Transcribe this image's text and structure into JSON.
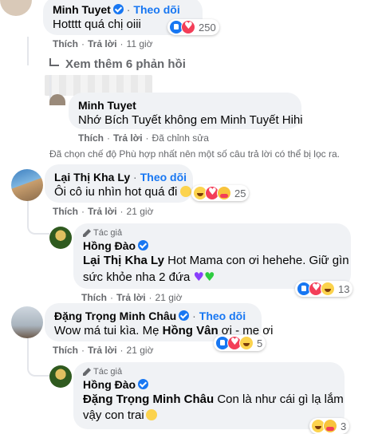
{
  "comments": [
    {
      "name": "Minh Tuyet",
      "follow": "Theo dõi",
      "text": "Hotttt quá chị oiii",
      "like": "Thích",
      "reply": "Trả lời",
      "time": "11 giờ",
      "reaction_count": "250"
    },
    {
      "name": "Lại Thị Kha Ly",
      "follow": "Theo dõi",
      "text": "Ôi cô iu nhìn hot quá đi",
      "like": "Thích",
      "reply": "Trả lời",
      "time": "21 giờ",
      "reaction_count": "25"
    },
    {
      "name": "Đặng Trọng Minh Châu",
      "follow": "Theo dõi",
      "text_prefix": "Wow má tui kìa. Mẹ",
      "mention": "Hồng Vân",
      "text_suffix": "ơi - mẹ ơi",
      "like": "Thích",
      "reply": "Trả lời",
      "time": "21 giờ",
      "reaction_count": "5"
    }
  ],
  "more_replies": "Xem thêm 6 phản hồi",
  "quoted_reply": {
    "name": "Minh Tuyet",
    "text": "Nhớ Bích Tuyết không em Minh Tuyết Hihi",
    "like": "Thích",
    "reply": "Trả lời",
    "edit": "Đã chỉnh sửa"
  },
  "filter_note": "Đã chọn chế độ Phù hợp nhất nên một số câu trả lời có thể bị lọc ra.",
  "replies": [
    {
      "author_badge": "Tác giả",
      "name": "Hồng Đào",
      "mention": "Lại Thị Kha Ly",
      "text_line1": "Hot Mama con ơi hehehe. Giữ gìn",
      "text_line2": "sức khỏe nha 2 đứa",
      "like": "Thích",
      "reply": "Trả lời",
      "time": "21 giờ",
      "reaction_count": "13"
    },
    {
      "author_badge": "Tác giả",
      "name": "Hồng Đào",
      "mention": "Đặng Trọng Minh Châu",
      "text_line1": "Con là như cái gì lạ lắm",
      "text_line2": "vậy con trai",
      "reaction_count": "3"
    }
  ],
  "colors": {
    "accent": "#1877f2",
    "bubble": "#f0f2f5",
    "meta": "#65676b"
  }
}
